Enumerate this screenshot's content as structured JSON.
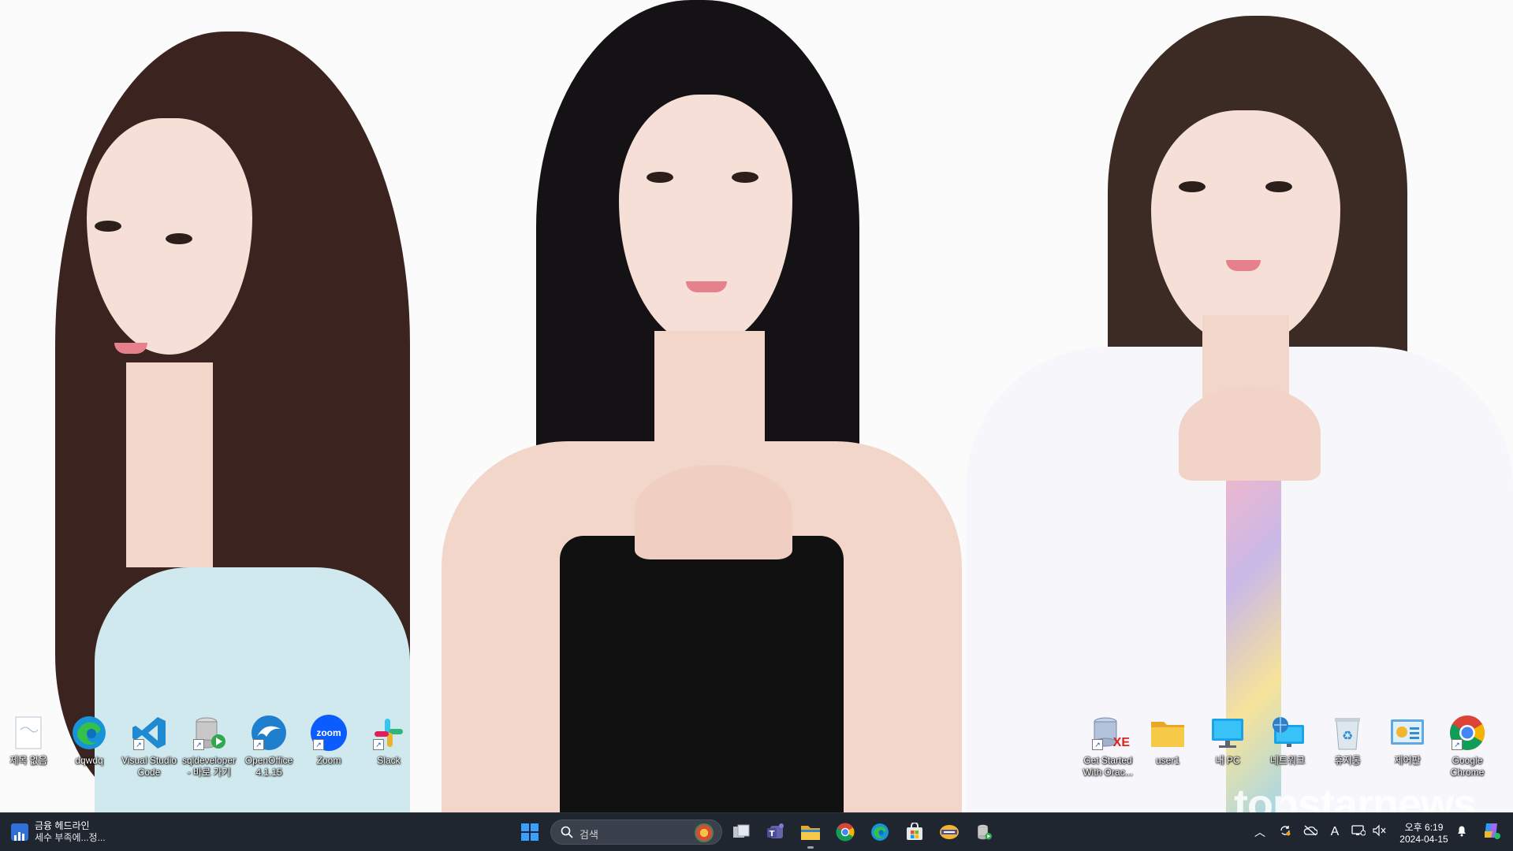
{
  "desktop": {
    "left_icons": [
      {
        "label": "제목 없음",
        "icon": "blank-document-icon"
      },
      {
        "label": "dqwdq",
        "icon": "edge-icon"
      },
      {
        "label": "Visual Studio\nCode",
        "icon": "vscode-icon"
      },
      {
        "label": "sqldeveloper\n- 바로 가기",
        "icon": "sqldeveloper-icon"
      },
      {
        "label": "OpenOffice\n4.1.15",
        "icon": "openoffice-icon"
      },
      {
        "label": "Zoom",
        "icon": "zoom-icon"
      },
      {
        "label": "Slack",
        "icon": "slack-icon"
      }
    ],
    "right_icons": [
      {
        "label": "Get Started\nWith Orac...",
        "icon": "oracle-xe-icon"
      },
      {
        "label": "user1",
        "icon": "folder-icon"
      },
      {
        "label": "내 PC",
        "icon": "this-pc-icon"
      },
      {
        "label": "네트워크",
        "icon": "network-icon"
      },
      {
        "label": "휴지통",
        "icon": "recycle-bin-icon"
      },
      {
        "label": "제어판",
        "icon": "control-panel-icon"
      },
      {
        "label": "Google\nChrome",
        "icon": "chrome-icon"
      }
    ],
    "zoom_glyph_text": "zoom",
    "xe_glyph_text": "XE",
    "wallpaper_watermark": "topstarnews"
  },
  "taskbar": {
    "news": {
      "title": "금융 헤드라인",
      "subtitle": "세수 부족에...정..."
    },
    "search": {
      "placeholder": "검색"
    },
    "pinned": [
      "windows-start-icon",
      "task-view-icon",
      "teams-icon",
      "file-explorer-icon",
      "chrome-icon",
      "edge-icon",
      "microsoft-store-icon",
      "terminal-app-icon",
      "sqldeveloper-icon"
    ],
    "tray": {
      "ime": "A",
      "time": "오후 6:19",
      "date": "2024-04-15"
    }
  },
  "colors": {
    "taskbar_bg": "#1f2630",
    "accent_blue": "#0a84ff",
    "folder_yellow": "#f7c948"
  }
}
